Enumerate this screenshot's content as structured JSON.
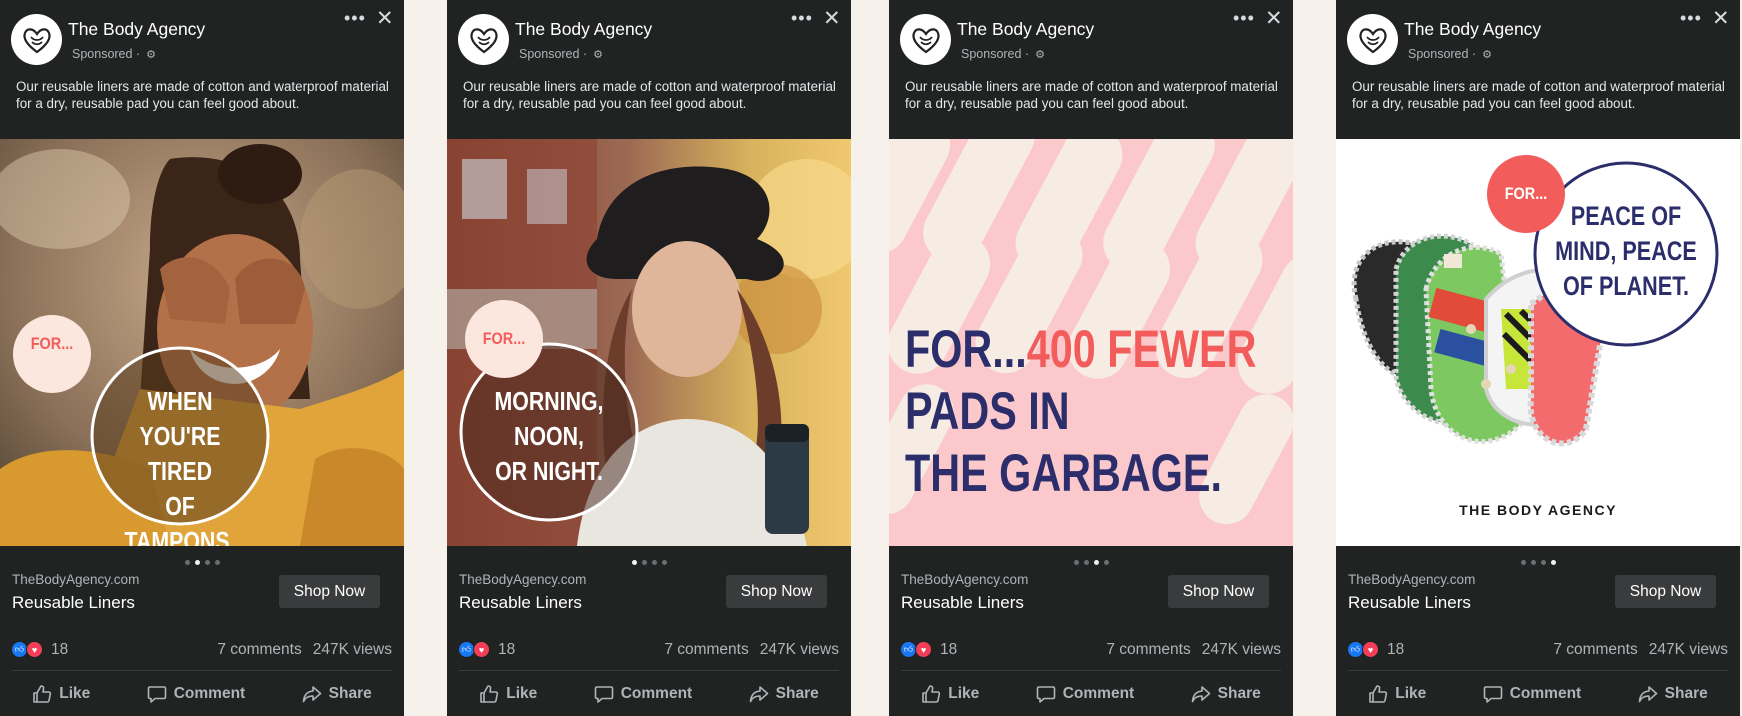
{
  "page_name": "The Body Agency",
  "sponsored_label": "Sponsored ·",
  "icons": {
    "logo": "heart-logo-icon",
    "privacy": "gear-icon",
    "more": "more-horizontal-icon",
    "close": "close-icon",
    "like_reaction": "thumbs-up-icon",
    "love_reaction": "heart-icon",
    "like": "thumbs-up-outline-icon",
    "comment": "comment-bubble-icon",
    "share": "share-arrow-icon"
  },
  "description": "Our reusable liners are made of cotton and waterproof material for a dry, reusable pad you can feel good about.",
  "domain": "TheBodyAgency.com",
  "product_name": "Reusable Liners",
  "cta_label": "Shop Now",
  "reaction_count": "18",
  "comments": "7 comments",
  "views": "247K views",
  "actions": {
    "like": "Like",
    "comment": "Comment",
    "share": "Share"
  },
  "colors": {
    "card_bg": "#212323",
    "page_bg": "#f7f1ec",
    "coral": "#f25c5a",
    "navy": "#2b2e6b",
    "pink_bg": "#fbc9cb",
    "like_blue": "#1877f2",
    "love_red": "#f33e58"
  },
  "slides": [
    {
      "badge": "FOR...",
      "lines": [
        "WHEN",
        "YOU'RE TIRED",
        "OF TAMPONS."
      ],
      "active_dot": 1
    },
    {
      "badge": "FOR...",
      "lines": [
        "MORNING,",
        "NOON,",
        "OR NIGHT."
      ],
      "active_dot": 0
    },
    {
      "prefix": "FOR...",
      "highlight": "400 FEWER",
      "lines": [
        "PADS IN",
        "THE GARBAGE."
      ],
      "active_dot": 2
    },
    {
      "badge": "FOR...",
      "lines": [
        "PEACE OF",
        "MIND, PEACE",
        "OF PLANET."
      ],
      "brand": "THE BODY AGENCY",
      "active_dot": 3
    }
  ]
}
